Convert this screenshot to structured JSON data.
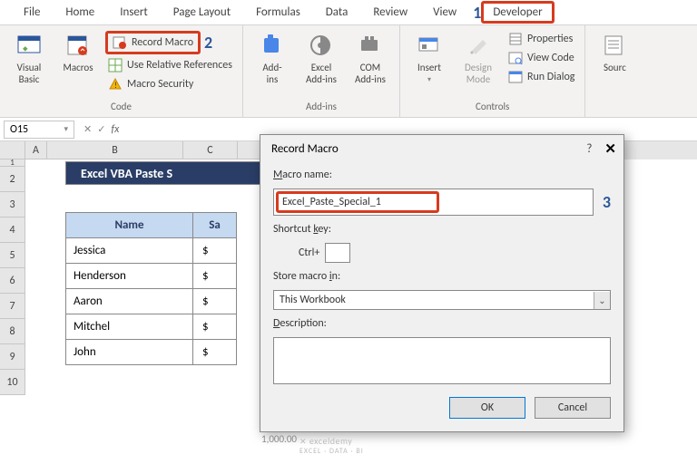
{
  "ribbon": {
    "tabs": [
      "File",
      "Home",
      "Insert",
      "Page Layout",
      "Formulas",
      "Data",
      "Review",
      "View",
      "Developer"
    ],
    "callouts": {
      "developer": "1",
      "record_macro": "2",
      "macro_name": "3"
    },
    "groups": {
      "code": {
        "label": "Code",
        "visual_basic": "Visual\nBasic",
        "macros": "Macros",
        "record_macro": "Record Macro",
        "use_relative": "Use Relative References",
        "macro_security": "Macro Security"
      },
      "addins": {
        "label": "Add-ins",
        "addins": "Add-\nins",
        "excel_addins": "Excel\nAdd-ins",
        "com_addins": "COM\nAdd-ins"
      },
      "controls": {
        "label": "Controls",
        "insert": "Insert",
        "design_mode": "Design\nMode",
        "properties": "Properties",
        "view_code": "View Code",
        "run_dialog": "Run Dialog"
      },
      "xml": {
        "source": "Sourc"
      }
    }
  },
  "formula_bar": {
    "name_box": "O15",
    "fx": "fx"
  },
  "columns": {
    "A": 24,
    "B": 150,
    "C": 60,
    "D": 90,
    "E": 90,
    "F": 90,
    "G": 90
  },
  "rows": [
    1,
    2,
    3,
    4,
    5,
    6,
    7,
    8,
    9,
    10
  ],
  "sheet": {
    "title": "Excel VBA Paste S",
    "headers": {
      "name": "Name",
      "salary": "Sa"
    },
    "rows": [
      {
        "name": "Jessica",
        "salary": "$"
      },
      {
        "name": "Henderson",
        "salary": "$"
      },
      {
        "name": "Aaron",
        "salary": "$"
      },
      {
        "name": "Mitchel",
        "salary": "$"
      },
      {
        "name": "John",
        "salary": "$"
      }
    ],
    "hidden_value": "1,000.00"
  },
  "dialog": {
    "title": "Record Macro",
    "help": "?",
    "close": "✕",
    "macro_name_label": "Macro name:",
    "macro_name_value": "Excel_Paste_Special_1",
    "shortcut_label": "Shortcut key:",
    "shortcut_prefix": "Ctrl+",
    "store_label": "Store macro in:",
    "store_value": "This Workbook",
    "description_label": "Description:",
    "ok": "OK",
    "cancel": "Cancel"
  },
  "watermark": {
    "brand": "exceldemy",
    "sub": "EXCEL · DATA · BI"
  }
}
